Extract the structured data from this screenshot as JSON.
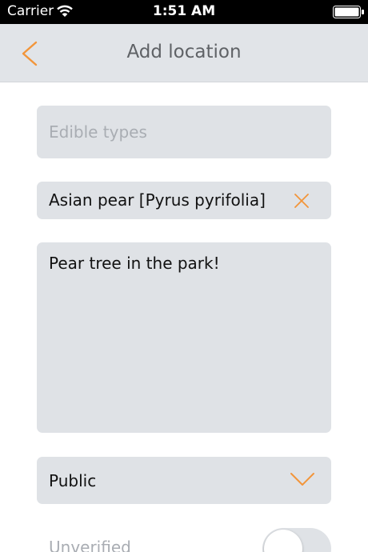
{
  "status_bar": {
    "carrier": "Carrier",
    "time": "1:51 AM"
  },
  "nav": {
    "title": "Add location",
    "back_icon": "chevron-left-icon"
  },
  "form": {
    "types_placeholder": "Edible types",
    "selected_type": "Asian pear [Pyrus pyrifolia]",
    "clear_icon": "close-icon",
    "description": "Pear tree in the park!",
    "access": "Public",
    "access_icon": "chevron-down-icon",
    "verified_label": "Unverified",
    "verified": false
  },
  "colors": {
    "accent": "#f2953a",
    "field_bg": "#dfe2e6",
    "nav_bg": "#e1e4e8"
  }
}
